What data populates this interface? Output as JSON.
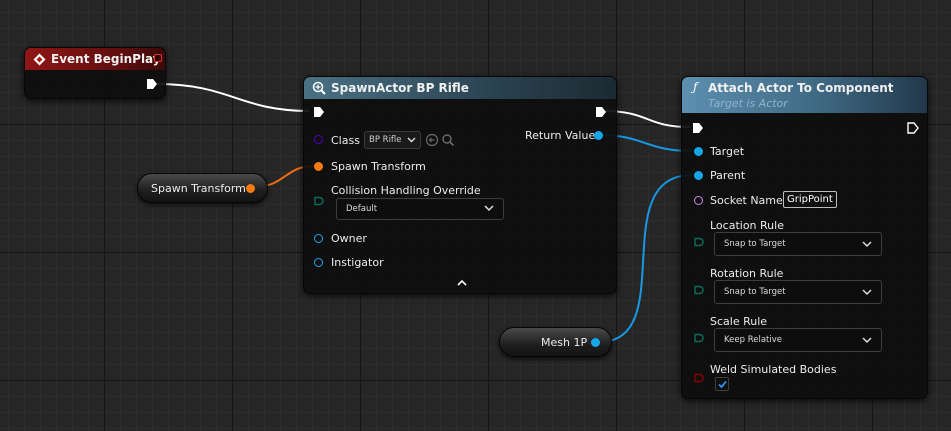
{
  "canvas": {
    "wire_colors": {
      "exec": "#ffffff",
      "transform": "#f06c13",
      "object": "#1799e3"
    }
  },
  "event_node": {
    "title": "Event BeginPlay",
    "header_color": "#7a1212",
    "icon": "event-diamond-icon"
  },
  "spawn_node": {
    "title": "SpawnActor BP Rifle",
    "header_color": "#3d5d6e",
    "icon": "spawn-actor-icon",
    "class_label": "Class",
    "class_value": "BP Rifle",
    "spawn_transform_label": "Spawn Transform",
    "collision_label": "Collision Handling Override",
    "collision_value": "Default",
    "owner_label": "Owner",
    "instigator_label": "Instigator",
    "return_label": "Return Value",
    "expand_icon": "chevron-up-icon"
  },
  "attach_node": {
    "title": "Attach Actor To Component",
    "subtitle": "Target is Actor",
    "header_color": "#4f7b96",
    "icon": "function-icon",
    "target_label": "Target",
    "parent_label": "Parent",
    "socket_label": "Socket Name",
    "socket_value": "GripPoint",
    "location_rule_label": "Location Rule",
    "location_rule_value": "Snap to Target",
    "rotation_rule_label": "Rotation Rule",
    "rotation_rule_value": "Snap to Target",
    "scale_rule_label": "Scale Rule",
    "scale_rule_value": "Keep Relative",
    "weld_label": "Weld Simulated Bodies",
    "weld_checked": true
  },
  "variables": {
    "spawn_transform": "Spawn Transform",
    "mesh": "Mesh 1P"
  },
  "pin_colors": {
    "exec": "#ffffff",
    "class": "#5a00b8",
    "struct_transform": "#f47a12",
    "byte_enum": "#0c6e5e",
    "object": "#16a7e8",
    "name": "#c98df0",
    "bool": "#8c0000"
  }
}
